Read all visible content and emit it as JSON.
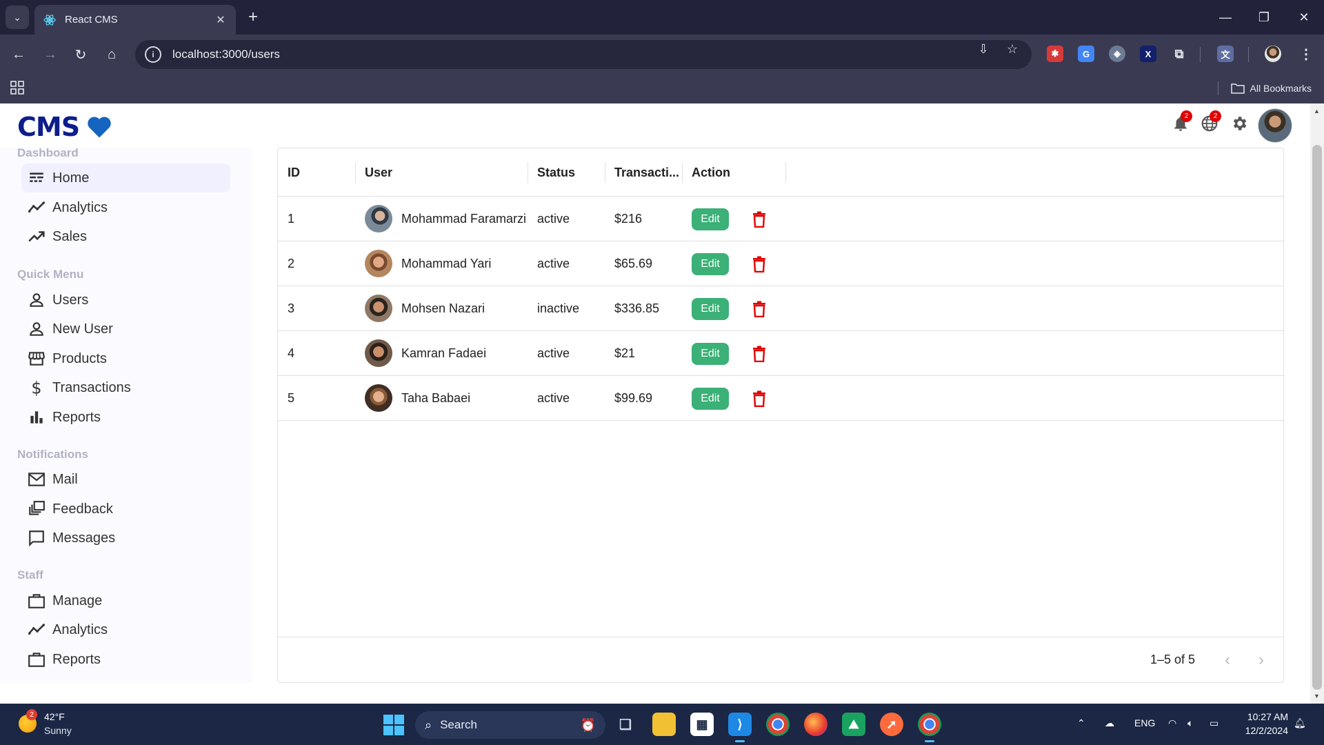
{
  "browser": {
    "tab_title": "React CMS",
    "url": "localhost:3000/users",
    "bookmarks_label": "All Bookmarks"
  },
  "app": {
    "logo_text": "CMS",
    "notifications_count": "2",
    "language_count": "2"
  },
  "sidebar": {
    "sections": [
      {
        "title": "Dashboard",
        "items": [
          {
            "label": "Home",
            "icon": "line-style-icon",
            "active": true
          },
          {
            "label": "Analytics",
            "icon": "timeline-icon"
          },
          {
            "label": "Sales",
            "icon": "trending-up-icon"
          }
        ]
      },
      {
        "title": "Quick Menu",
        "items": [
          {
            "label": "Users",
            "icon": "person-icon"
          },
          {
            "label": "New User",
            "icon": "person-icon"
          },
          {
            "label": "Products",
            "icon": "storefront-icon"
          },
          {
            "label": "Transactions",
            "icon": "dollar-icon"
          },
          {
            "label": "Reports",
            "icon": "bar-chart-icon"
          }
        ]
      },
      {
        "title": "Notifications",
        "items": [
          {
            "label": "Mail",
            "icon": "mail-icon"
          },
          {
            "label": "Feedback",
            "icon": "dynamic-feed-icon"
          },
          {
            "label": "Messages",
            "icon": "chat-bubble-icon"
          }
        ]
      },
      {
        "title": "Staff",
        "items": [
          {
            "label": "Manage",
            "icon": "work-icon"
          },
          {
            "label": "Analytics",
            "icon": "timeline-icon"
          },
          {
            "label": "Reports",
            "icon": "work-icon"
          }
        ]
      }
    ]
  },
  "table": {
    "columns": [
      "ID",
      "User",
      "Status",
      "Transacti...",
      "Action"
    ],
    "edit_label": "Edit",
    "rows": [
      {
        "id": "1",
        "user": "Mohammad Faramarzi",
        "status": "active",
        "transaction": "$216"
      },
      {
        "id": "2",
        "user": "Mohammad Yari",
        "status": "active",
        "transaction": "$65.69"
      },
      {
        "id": "3",
        "user": "Mohsen Nazari",
        "status": "inactive",
        "transaction": "$336.85"
      },
      {
        "id": "4",
        "user": "Kamran Fadaei",
        "status": "active",
        "transaction": "$21"
      },
      {
        "id": "5",
        "user": "Taha Babaei",
        "status": "active",
        "transaction": "$99.69"
      }
    ],
    "pagination": "1–5 of 5"
  },
  "taskbar": {
    "weather_badge": "2",
    "temperature": "42°F",
    "condition": "Sunny",
    "search_label": "Search",
    "language": "ENG",
    "time": "10:27 AM",
    "date": "12/2/2024"
  },
  "colors": {
    "edit_button": "#3bb077",
    "delete_icon": "#e10000",
    "logo": "#0d1e8c",
    "heart": "#1565c0",
    "sidebar_title": "#b2b1c4"
  }
}
